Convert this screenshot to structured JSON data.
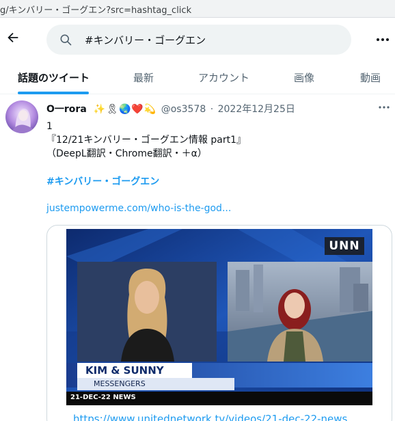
{
  "browser": {
    "url_fragment": "g/キンバリー・ゴーグエン?src=hashtag_click"
  },
  "search": {
    "query": "#キンバリー・ゴーグエン"
  },
  "tabs": [
    {
      "label": "話題のツイート",
      "active": true
    },
    {
      "label": "最新",
      "active": false
    },
    {
      "label": "アカウント",
      "active": false
    },
    {
      "label": "画像",
      "active": false
    },
    {
      "label": "動画",
      "active": false
    }
  ],
  "tweet": {
    "author_name": "O一rora",
    "emoji": "✨🎗🌏❤️💫",
    "handle": "@os3578",
    "separator": "·",
    "date": "2022年12月25日",
    "text_lines": [
      "1",
      "『12/21キンバリー・ゴーグエン情報  part1』",
      "（DeepL翻訳・Chrome翻訳・＋α）"
    ],
    "hashtag": "#キンバリー・ゴーグエン",
    "link": "justempowerme.com/who-is-the-god...",
    "card": {
      "network_logo": "UNN",
      "lower_third": "KIM & SUNNY",
      "ticker": "MESSENGERS",
      "date_ticker": "21-DEC-22 NEWS",
      "link_text": "https://www.unitednetwork.tv/videos/21-dec-22-news"
    }
  },
  "colors": {
    "accent": "#1d9bf0",
    "secondary_text": "#536471",
    "primary_text": "#0f1419"
  }
}
